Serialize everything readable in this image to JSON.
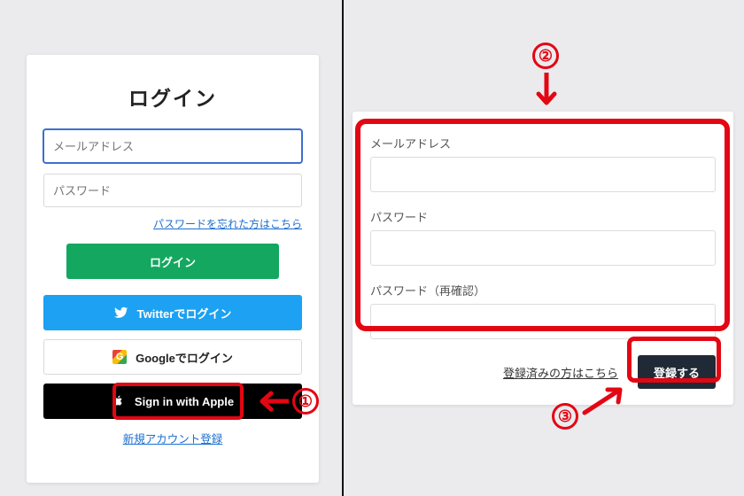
{
  "login": {
    "title": "ログイン",
    "email_placeholder": "メールアドレス",
    "password_placeholder": "パスワード",
    "forgot_link": "パスワードを忘れた方はこちら",
    "login_button": "ログイン",
    "twitter_button": "Twitterでログイン",
    "google_button": "Googleでログイン",
    "apple_button": "Sign in with Apple",
    "new_account_link": "新規アカウント登録"
  },
  "signup": {
    "email_label": "メールアドレス",
    "password_label": "パスワード",
    "password_confirm_label": "パスワード（再確認）",
    "already_link": "登録済みの方はこちら",
    "register_button": "登録する"
  },
  "callouts": {
    "one": "①",
    "two": "②",
    "three": "③"
  }
}
